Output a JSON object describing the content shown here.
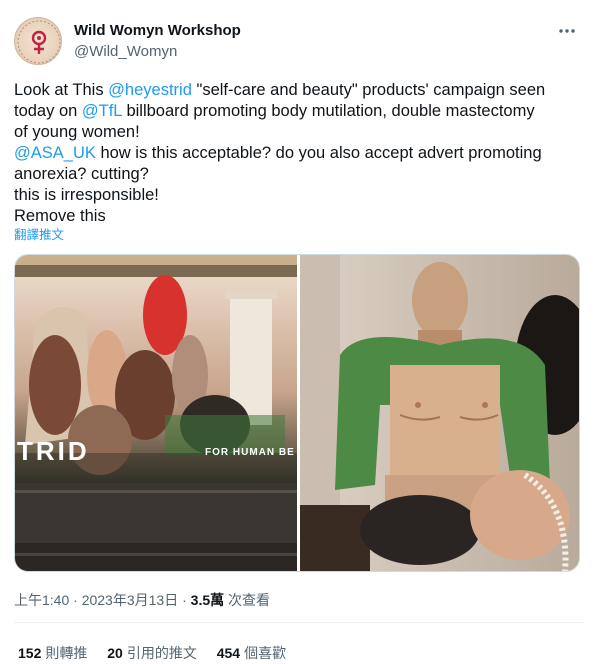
{
  "author": {
    "display_name": "Wild Womyn Workshop",
    "handle": "@Wild_Womyn",
    "avatar_text": "WILD WOMYN WORKSHOP"
  },
  "tweet": {
    "line1_a": "Look at This ",
    "line1_mention": "@heyestrid",
    "line1_b": " \"self-care and beauty\" products' campaign seen",
    "line2_a": "today on ",
    "line2_mention": "@TfL",
    "line2_b": " billboard promoting body mutilation, double mastectomy",
    "line3": "of young women!",
    "line4_mention": "@ASA_UK",
    "line4_b": " how is this acceptable? do you also accept advert promoting",
    "line5": "anorexia? cutting?",
    "line6": "this is irresponsible!",
    "line7": "Remove this"
  },
  "translate_label": "翻譯推文",
  "media": {
    "left_caption": "TRID",
    "left_tagline": "FOR HUMAN BE"
  },
  "meta": {
    "time": "上午1:40",
    "sep1": " · ",
    "date": "2023年3月13日",
    "sep2": " · ",
    "views_count": "3.5萬",
    "views_label": " 次查看"
  },
  "stats": {
    "retweets_count": "152",
    "retweets_label": "則轉推",
    "quotes_count": "20",
    "quotes_label": "引用的推文",
    "likes_count": "454",
    "likes_label": "個喜歡"
  },
  "colors": {
    "link": "#1d9bf0",
    "text": "#0f1419",
    "muted": "#536471"
  }
}
